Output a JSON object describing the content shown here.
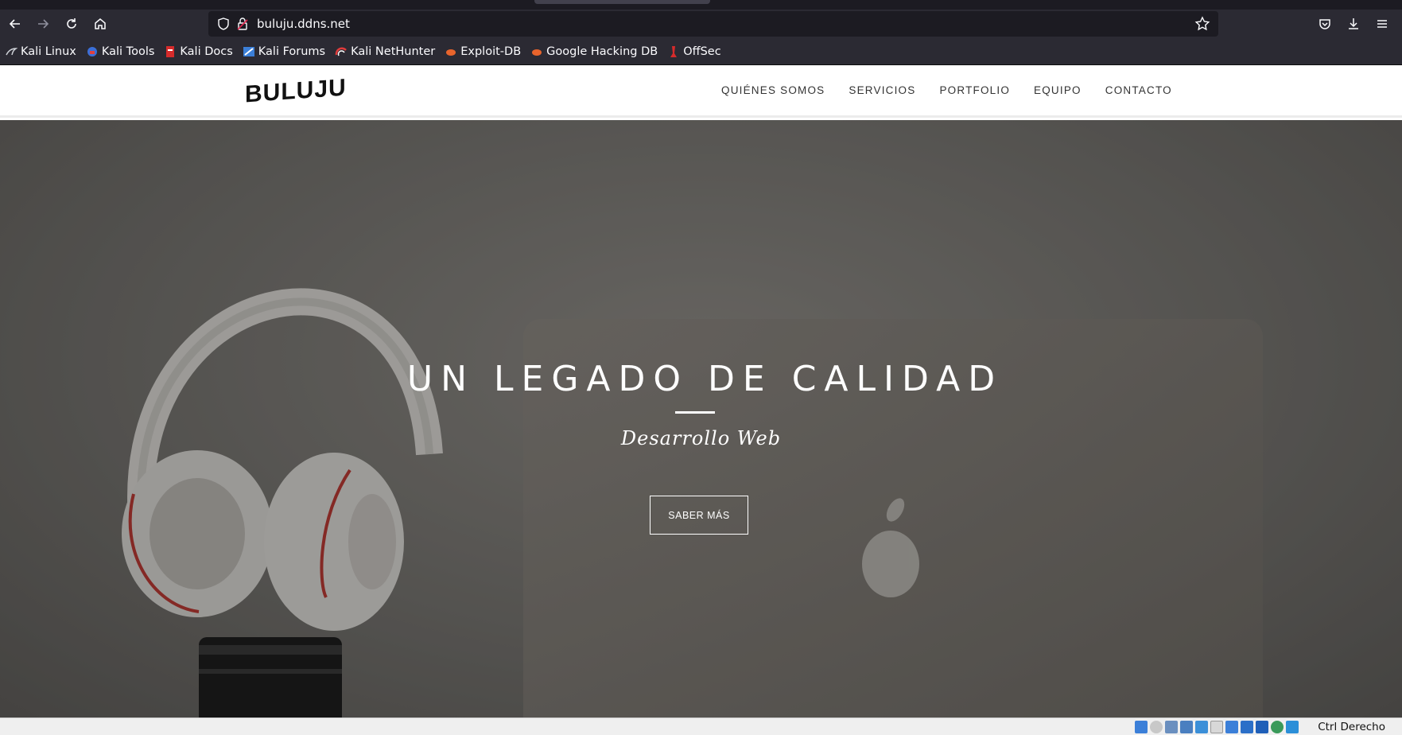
{
  "browser": {
    "url": "buluju.ddns.net",
    "bookmarks": [
      {
        "label": "Kali Linux",
        "icon": "kali-dragon-icon"
      },
      {
        "label": "Kali Tools",
        "icon": "kali-tools-icon"
      },
      {
        "label": "Kali Docs",
        "icon": "kali-docs-icon"
      },
      {
        "label": "Kali Forums",
        "icon": "kali-forums-icon"
      },
      {
        "label": "Kali NetHunter",
        "icon": "nethunter-icon"
      },
      {
        "label": "Exploit-DB",
        "icon": "exploit-db-icon"
      },
      {
        "label": "Google Hacking DB",
        "icon": "ghdb-icon"
      },
      {
        "label": "OffSec",
        "icon": "offsec-icon"
      }
    ]
  },
  "site": {
    "logo": "BULUJU",
    "nav": [
      "QUIÉNES SOMOS",
      "SERVICIOS",
      "PORTFOLIO",
      "EQUIPO",
      "CONTACTO"
    ],
    "hero": {
      "title": "UN LEGADO DE CALIDAD",
      "subtitle": "Desarrollo Web",
      "button": "SABER MÁS"
    }
  },
  "vbox": {
    "host_key": "Ctrl Derecho"
  },
  "colors": {
    "chrome_bg": "#2b2a33",
    "urlbar_bg": "#1c1b22",
    "hero_overlay": "#75736f",
    "text_light": "#fbfbfe"
  }
}
